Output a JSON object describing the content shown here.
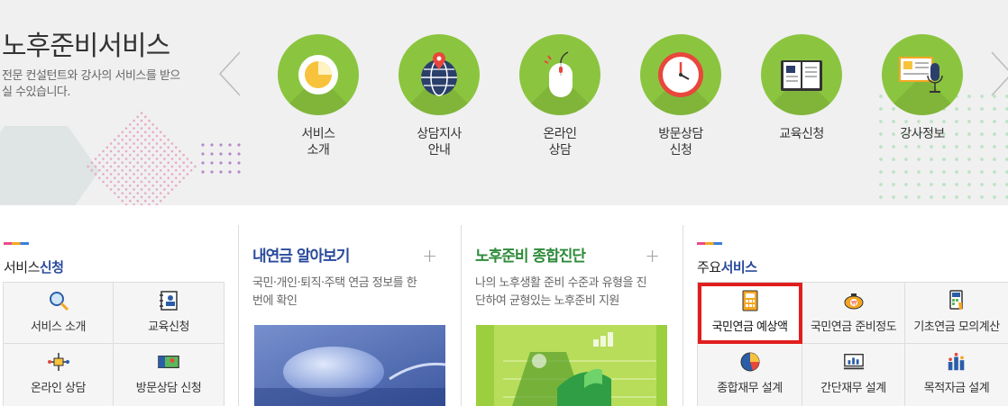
{
  "banner": {
    "title": "노후준비서비스",
    "desc": "전문 컨설턴트와 강사의 서비스를 받으실 수있습니다.",
    "services": [
      {
        "label": "서비스\n소개",
        "icon": "clock-plate-icon"
      },
      {
        "label": "상담지사\n안내",
        "icon": "globe-pin-icon"
      },
      {
        "label": "온라인\n상담",
        "icon": "mouse-icon"
      },
      {
        "label": "방문상담\n신청",
        "icon": "clock-icon"
      },
      {
        "label": "교육신청",
        "icon": "book-icon"
      },
      {
        "label": "강사정보",
        "icon": "microphone-board-icon"
      }
    ]
  },
  "panel1": {
    "title_pre": "서비스",
    "title_em": "신청",
    "items": [
      "서비스 소개",
      "교육신청",
      "온라인 상담",
      "방문상담 신청"
    ]
  },
  "panel2": {
    "title": "내연금 알아보기",
    "plus": "+",
    "text": "국민·개인·퇴직·주택 연금 정보를 한 번에 확인"
  },
  "panel3": {
    "title": "노후준비 종합진단",
    "plus": "+",
    "text": "나의 노후생활 준비 수준과 유형을 진단하여 균형있는 노후준비 지원"
  },
  "panel4": {
    "title_pre": "주요",
    "title_em": "서비스",
    "items": [
      "국민연금 예상액",
      "국민연금 준비정도",
      "기초연금 모의계산",
      "종합재무 설계",
      "간단재무 설계",
      "목적자금 설계"
    ],
    "selected": "국민연금 예상액"
  },
  "colors": {
    "accent_green": "#8bc53f",
    "highlight_red": "#e01e1e",
    "title_blue": "#2a4a9c",
    "title_green": "#2e8b3a"
  }
}
